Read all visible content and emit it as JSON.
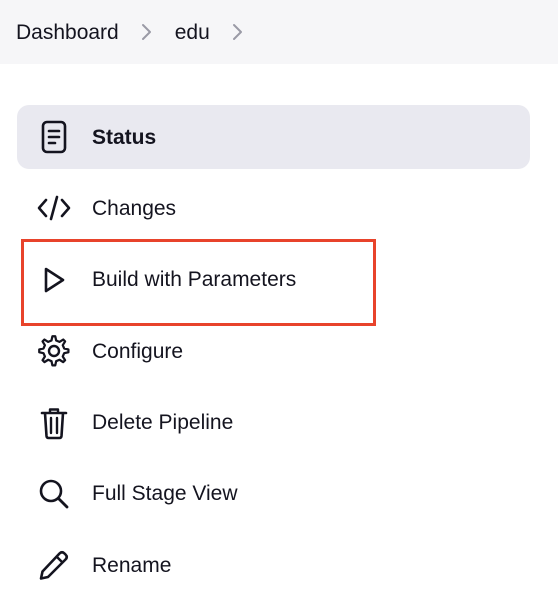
{
  "breadcrumb": {
    "items": [
      {
        "label": "Dashboard"
      },
      {
        "label": "edu"
      }
    ]
  },
  "tasks": {
    "items": [
      {
        "label": "Status",
        "icon": "document-icon",
        "active": true
      },
      {
        "label": "Changes",
        "icon": "code-icon",
        "active": false
      },
      {
        "label": "Build with Parameters",
        "icon": "play-icon",
        "active": false,
        "highlighted": true
      },
      {
        "label": "Configure",
        "icon": "gear-icon",
        "active": false
      },
      {
        "label": "Delete Pipeline",
        "icon": "trash-icon",
        "active": false
      },
      {
        "label": "Full Stage View",
        "icon": "search-icon",
        "active": false
      },
      {
        "label": "Rename",
        "icon": "pencil-icon",
        "active": false
      }
    ]
  },
  "colors": {
    "active_bg": "#e9e9f0",
    "breadcrumb_bg": "#f6f6f8",
    "highlight_border": "#e8432b",
    "text": "#14141f"
  }
}
